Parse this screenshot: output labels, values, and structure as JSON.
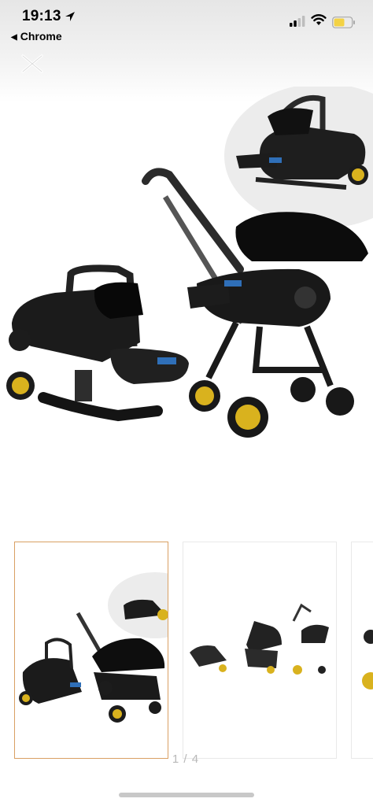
{
  "status_bar": {
    "time": "19:13",
    "back_label": "Chrome",
    "battery_color": "#f3d244"
  },
  "gallery": {
    "counter": "1 / 4",
    "active_index": 0,
    "thumbnail_count": 4
  },
  "colors": {
    "accent_wheel": "#d9b21e",
    "frame": "#222222",
    "active_border": "#d9a063"
  }
}
